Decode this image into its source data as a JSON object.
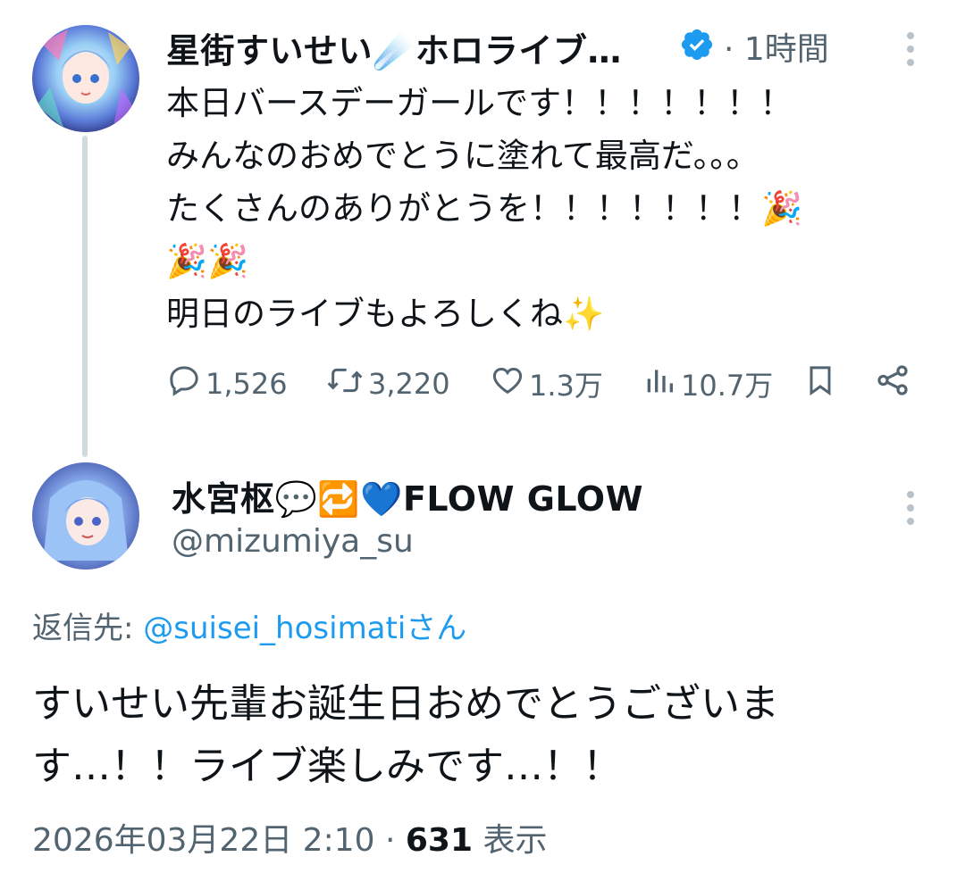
{
  "colors": {
    "accent": "#1d9bf0",
    "muted": "#536471",
    "text": "#0f1419",
    "thread_line": "#cfd9de"
  },
  "tweet": {
    "author_name": "星街すいせい☄️ホロライブ…",
    "time": "· 1時間",
    "text": "本日バースデーガールです！！！！！！！\nみんなのおめでとうに塗れて最高だ。。。\nたくさんのありがとうを！！！！！！！🎉\n🎉🎉\n明日のライブもよろしくね✨",
    "actions": {
      "replies": "1,526",
      "retweets": "3,220",
      "likes": "1.3万",
      "views": "10.7万"
    }
  },
  "reply": {
    "author_name": "水宮枢💬🔁💙FLOW GLOW",
    "handle": "@mizumiya_su",
    "reply_to_label": "返信先: ",
    "reply_to_mention": "@suisei_hosimatiさん",
    "text": "すいせい先輩お誕生日おめでとうございま\nす…！！ライブ楽しみです…！！",
    "date": "2026年03月22日 2:10 · ",
    "views_count": "631",
    "views_label": " 表示"
  },
  "icons": [
    "reply-icon",
    "retweet-icon",
    "like-icon",
    "views-icon",
    "bookmark-icon",
    "share-icon",
    "verified-icon",
    "more-icon"
  ]
}
